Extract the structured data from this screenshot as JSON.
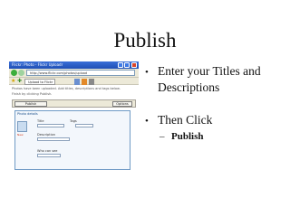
{
  "slide": {
    "title": "Publish",
    "bullets": [
      "Enter your Titles and Descriptions",
      "Then Click"
    ],
    "sub_bullet": "Publish",
    "sub_dash": "–",
    "bullet_glyph": "•"
  },
  "screenshot": {
    "window_title": "Flickr: Photo - Flickr Uploadr",
    "address": "http://www.flickr.com/photos/upload",
    "tab_label": "Upload to Flickr",
    "page_label": "Page",
    "tools_label": "Tools",
    "text_line_1": "Photos have been uploaded. Add titles, descriptions and tags below.",
    "text_line_2": "Finish by clicking Publish.",
    "publish_button": "Publish",
    "options_button": "Options",
    "form_header": "Photo details",
    "photo_tag": "New",
    "title_label": "Title",
    "description_label": "Description",
    "tags_label": "Tags",
    "visibility_label": "Who can see"
  },
  "colors": {
    "title_bar": "#2a5bc7",
    "chrome": "#ece9d8",
    "form_border": "#6f9ac5"
  }
}
